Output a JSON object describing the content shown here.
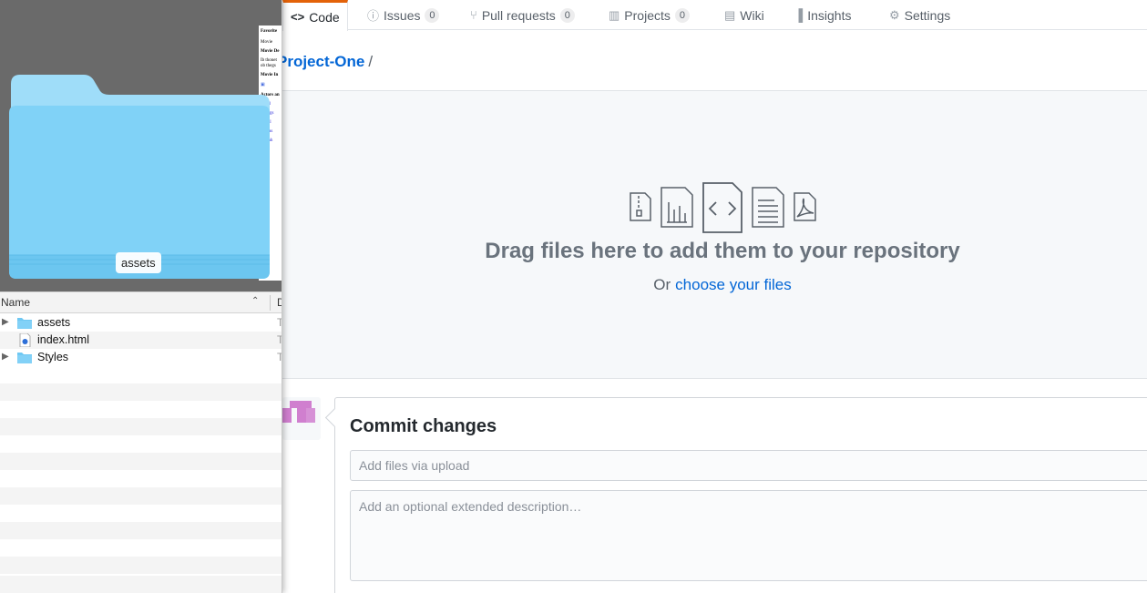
{
  "repo_nav": {
    "tabs": [
      {
        "label": "Code",
        "icon": "code-icon",
        "selected": true
      },
      {
        "label": "Issues",
        "icon": "issue-icon",
        "count": "0"
      },
      {
        "label": "Pull requests",
        "icon": "pull-request-icon",
        "count": "0"
      },
      {
        "label": "Projects",
        "icon": "project-icon",
        "count": "0"
      },
      {
        "label": "Wiki",
        "icon": "book-icon"
      },
      {
        "label": "Insights",
        "icon": "graph-icon"
      },
      {
        "label": "Settings",
        "icon": "gear-icon"
      }
    ]
  },
  "breadcrumb": {
    "repo": "Project-One",
    "separator": "/"
  },
  "upload": {
    "title": "Drag files here to add them to your repository",
    "prefix": "Or",
    "link": "choose your files",
    "file_icons": [
      "file-zip-icon",
      "file-chart-icon",
      "file-code-icon",
      "file-text-icon",
      "file-pdf-icon"
    ]
  },
  "commit": {
    "title": "Commit changes",
    "summary_placeholder": "Add files via upload",
    "description_placeholder": "Add an optional extended description…"
  },
  "finder": {
    "preview_label": "assets",
    "column_name": "Name",
    "column_next": "D",
    "rows": [
      {
        "name": "assets",
        "type": "folder",
        "expandable": true,
        "kind_initial": "T"
      },
      {
        "name": "index.html",
        "type": "html-file",
        "expandable": false,
        "kind_initial": "T"
      },
      {
        "name": "Styles",
        "type": "folder",
        "expandable": true,
        "kind_initial": "T"
      }
    ]
  },
  "colors": {
    "link": "#0366d6",
    "tab_accent": "#e36209",
    "folder_blue": "#76cdf6",
    "avatar_pink": "#d07fcf"
  }
}
